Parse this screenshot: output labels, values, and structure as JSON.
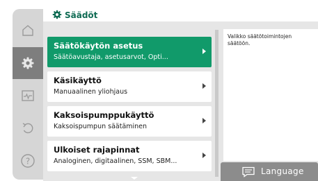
{
  "header": {
    "title": "Säädöt",
    "accent_color": "#0f6b53",
    "icon": "gear-icon"
  },
  "rail": {
    "items": [
      {
        "name": "home",
        "icon": "home-icon",
        "active": false
      },
      {
        "name": "settings",
        "icon": "gear-icon",
        "active": true
      },
      {
        "name": "diagnostics",
        "icon": "monitor-pulse-icon",
        "active": false
      },
      {
        "name": "restore",
        "icon": "undo-icon",
        "active": false
      },
      {
        "name": "help",
        "icon": "help-icon",
        "active": false
      }
    ]
  },
  "menu": {
    "items": [
      {
        "title": "Säätökäytön asetus",
        "subtitle": "Säätöavustaja, asetusarvot, Opti...",
        "selected": true
      },
      {
        "title": "Käsikäyttö",
        "subtitle": "Manuaalinen yliohjaus",
        "selected": false
      },
      {
        "title": "Kaksoispumppukäyttö",
        "subtitle": "Kaksoispumpun säätäminen",
        "selected": false
      },
      {
        "title": "Ulkoiset rajapinnat",
        "subtitle": "Analoginen, digitaalinen, SSM, SBM...",
        "selected": false
      }
    ],
    "selected_color": "#119a6a"
  },
  "help": {
    "text": "Valikko säätötoimintojen säätöön."
  },
  "language": {
    "label": "Language",
    "icon": "message-icon"
  }
}
